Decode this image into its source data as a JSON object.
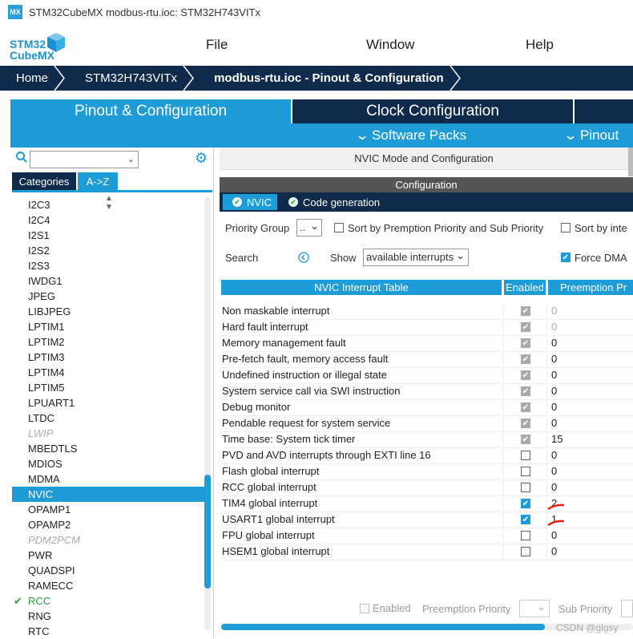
{
  "window": {
    "title": "STM32CubeMX modbus-rtu.ioc: STM32H743VITx",
    "badge": "MX"
  },
  "logo": {
    "line1": "STM32",
    "line2": "CubeMX"
  },
  "menu": [
    "File",
    "Window",
    "Help"
  ],
  "breadcrumb": [
    "Home",
    "STM32H743VITx",
    "modbus-rtu.ioc - Pinout & Configuration"
  ],
  "tabs": {
    "pinout": "Pinout & Configuration",
    "clock": "Clock Configuration"
  },
  "subbar": {
    "software_packs": "Software Packs",
    "pinout": "Pinout"
  },
  "left": {
    "search_value": "",
    "tab_categories": "Categories",
    "tab_az": "A->Z",
    "items": [
      {
        "label": "I2C3",
        "state": "normal"
      },
      {
        "label": "I2C4",
        "state": "normal"
      },
      {
        "label": "I2S1",
        "state": "normal"
      },
      {
        "label": "I2S2",
        "state": "normal"
      },
      {
        "label": "I2S3",
        "state": "normal"
      },
      {
        "label": "IWDG1",
        "state": "normal"
      },
      {
        "label": "JPEG",
        "state": "normal"
      },
      {
        "label": "LIBJPEG",
        "state": "normal"
      },
      {
        "label": "LPTIM1",
        "state": "normal"
      },
      {
        "label": "LPTIM2",
        "state": "normal"
      },
      {
        "label": "LPTIM3",
        "state": "normal"
      },
      {
        "label": "LPTIM4",
        "state": "normal"
      },
      {
        "label": "LPTIM5",
        "state": "normal"
      },
      {
        "label": "LPUART1",
        "state": "normal"
      },
      {
        "label": "LTDC",
        "state": "normal"
      },
      {
        "label": "LWIP",
        "state": "disabled"
      },
      {
        "label": "MBEDTLS",
        "state": "normal"
      },
      {
        "label": "MDIOS",
        "state": "normal"
      },
      {
        "label": "MDMA",
        "state": "normal"
      },
      {
        "label": "NVIC",
        "state": "selected"
      },
      {
        "label": "OPAMP1",
        "state": "normal"
      },
      {
        "label": "OPAMP2",
        "state": "normal"
      },
      {
        "label": "PDM2PCM",
        "state": "disabled"
      },
      {
        "label": "PWR",
        "state": "normal"
      },
      {
        "label": "QUADSPI",
        "state": "normal"
      },
      {
        "label": "RAMECC",
        "state": "normal"
      },
      {
        "label": "RCC",
        "state": "configured"
      },
      {
        "label": "RNG",
        "state": "normal"
      },
      {
        "label": "RTC",
        "state": "normal"
      }
    ]
  },
  "right": {
    "mode_header": "NVIC Mode and Configuration",
    "config_header": "Configuration",
    "subtab_nvic": "NVIC",
    "subtab_codegen": "Code generation",
    "priority_group_label": "Priority Group",
    "priority_group_value": "..",
    "sort_premption_label": "Sort by Premption Priority and Sub Priority",
    "sort_inte_label": "Sort by inte",
    "search_label": "Search",
    "show_label": "Show",
    "show_value": "available interrupts",
    "force_dma_label": "Force DMA",
    "col_table": "NVIC Interrupt Table",
    "col_enabled": "Enabled",
    "col_preemption": "Preemption Pr",
    "rows": [
      {
        "name": "Non maskable interrupt",
        "enabled": "disabled-checked",
        "prio": "0",
        "prio_dim": true
      },
      {
        "name": "Hard fault interrupt",
        "enabled": "disabled-checked",
        "prio": "0",
        "prio_dim": true
      },
      {
        "name": "Memory management fault",
        "enabled": "disabled-checked",
        "prio": "0",
        "prio_dim": false
      },
      {
        "name": "Pre-fetch fault, memory access fault",
        "enabled": "disabled-checked",
        "prio": "0",
        "prio_dim": false
      },
      {
        "name": "Undefined instruction or illegal state",
        "enabled": "disabled-checked",
        "prio": "0",
        "prio_dim": false
      },
      {
        "name": "System service call via SWI instruction",
        "enabled": "disabled-checked",
        "prio": "0",
        "prio_dim": false
      },
      {
        "name": "Debug monitor",
        "enabled": "disabled-checked",
        "prio": "0",
        "prio_dim": false
      },
      {
        "name": "Pendable request for system service",
        "enabled": "disabled-checked",
        "prio": "0",
        "prio_dim": false
      },
      {
        "name": "Time base: System tick timer",
        "enabled": "disabled-checked",
        "prio": "15",
        "prio_dim": false
      },
      {
        "name": "PVD and AVD interrupts through EXTI line 16",
        "enabled": "off",
        "prio": "0",
        "prio_dim": false
      },
      {
        "name": "Flash global interrupt",
        "enabled": "off",
        "prio": "0",
        "prio_dim": false
      },
      {
        "name": "RCC global interrupt",
        "enabled": "off",
        "prio": "0",
        "prio_dim": false
      },
      {
        "name": "TIM4 global interrupt",
        "enabled": "on",
        "prio": "2",
        "prio_dim": false
      },
      {
        "name": "USART1 global interrupt",
        "enabled": "on",
        "prio": "1",
        "prio_dim": false
      },
      {
        "name": "FPU global interrupt",
        "enabled": "off",
        "prio": "0",
        "prio_dim": false
      },
      {
        "name": "HSEM1 global interrupt",
        "enabled": "off",
        "prio": "0",
        "prio_dim": false
      }
    ],
    "bottom": {
      "enabled_label": "Enabled",
      "preemption_label": "Preemption Priority",
      "sub_label": "Sub Priority"
    }
  },
  "watermark": "CSDN @glgsy",
  "colors": {
    "accent": "#1d9cd8",
    "navy": "#0f2a4a",
    "green": "#2e9e3a",
    "annotation_red": "#e21"
  }
}
